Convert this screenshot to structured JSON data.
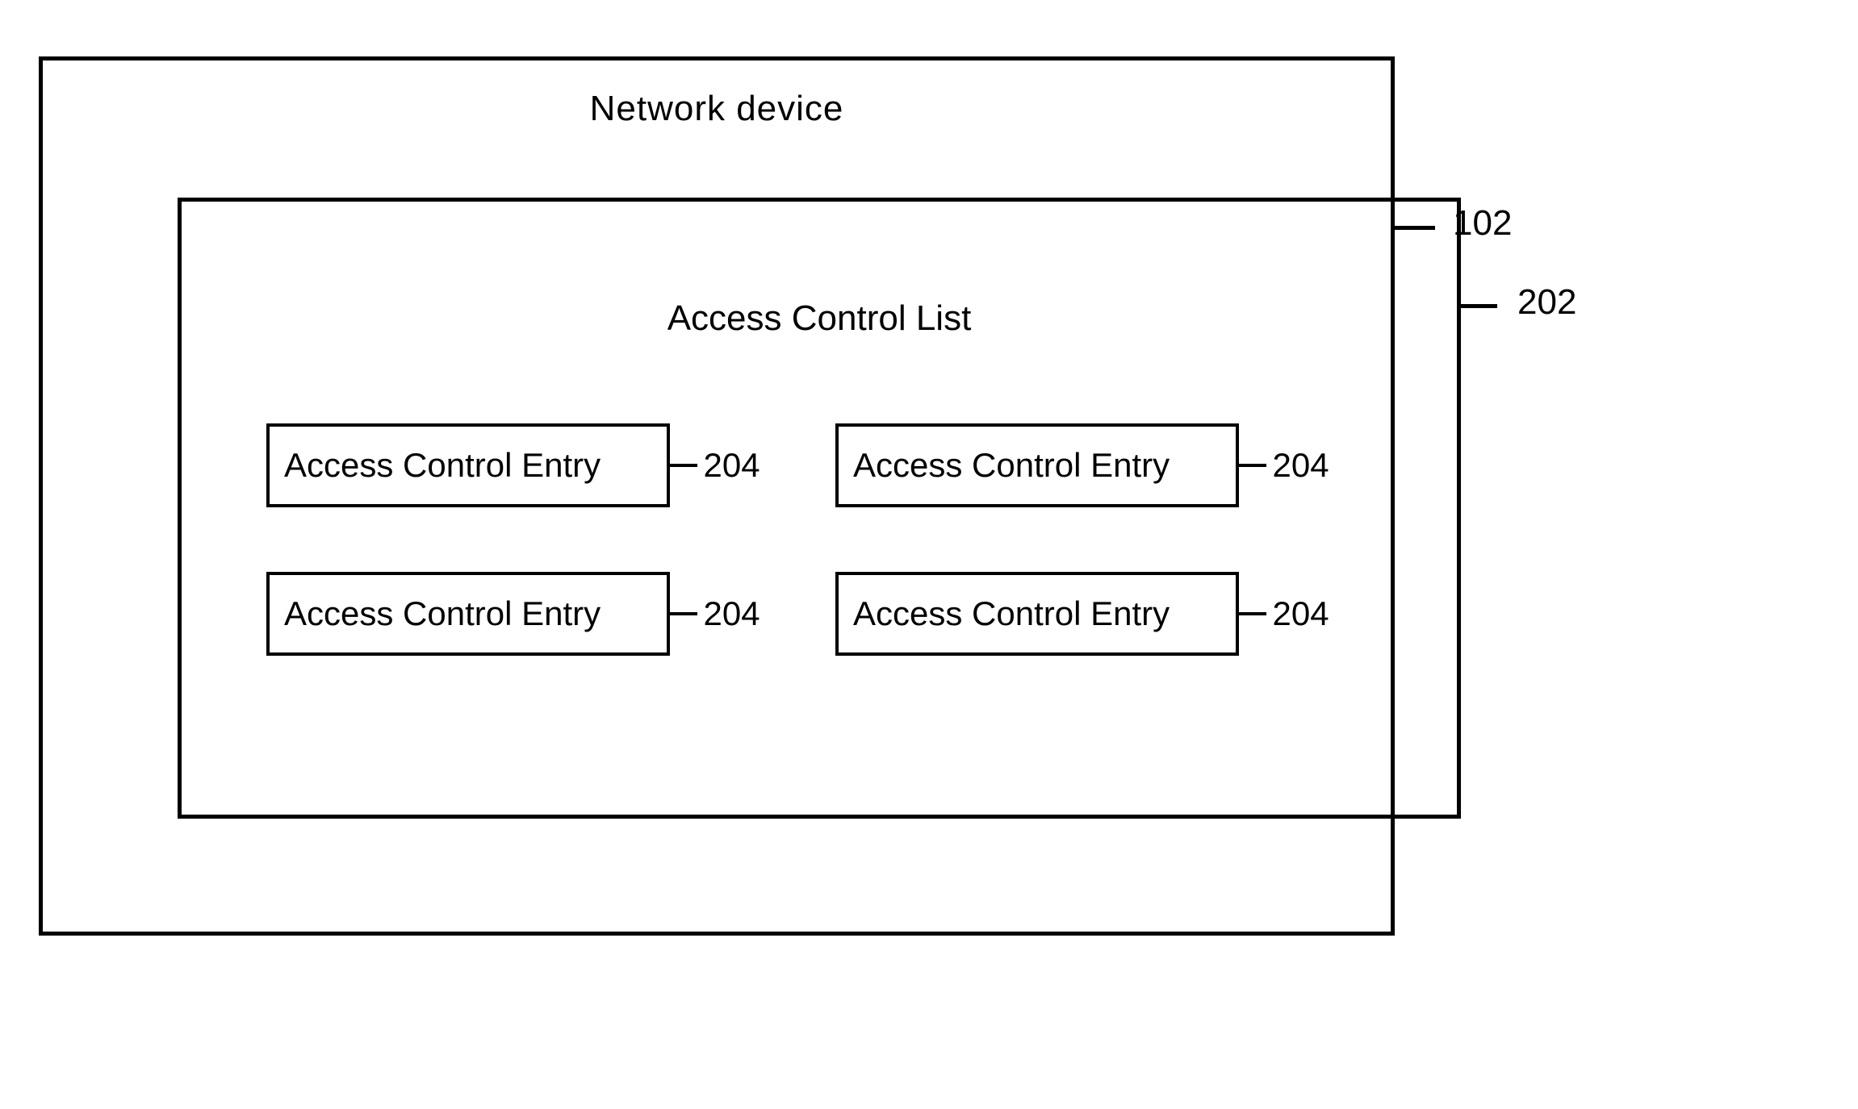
{
  "outer": {
    "title": "Network  device",
    "ref": "102"
  },
  "inner": {
    "title": "Access Control List",
    "ref": "202"
  },
  "entries": [
    {
      "label": "Access Control Entry",
      "ref": "204"
    },
    {
      "label": "Access Control Entry",
      "ref": "204"
    },
    {
      "label": "Access Control Entry",
      "ref": "204"
    },
    {
      "label": "Access Control Entry",
      "ref": "204"
    }
  ]
}
